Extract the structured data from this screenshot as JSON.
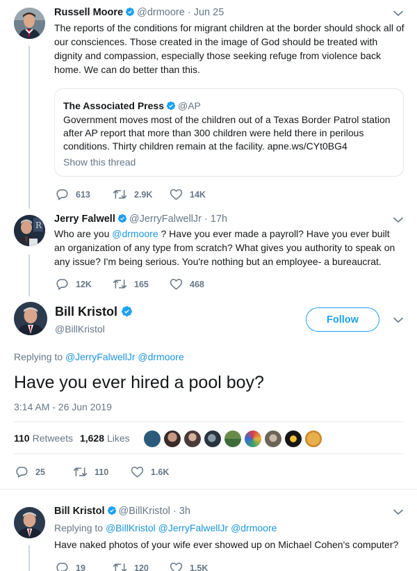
{
  "tweet1": {
    "name": "Russell Moore",
    "handle": "@drmoore",
    "sep": " · ",
    "time": "Jun 25",
    "text": "The reports of the conditions for migrant children at the border should shock all of our consciences. Those created in the image of God should be treated with dignity and compassion, especially those seeking refuge from violence back home. We can do better than this.",
    "quote": {
      "name": "The Associated Press",
      "handle": "@AP",
      "text": "Government moves most of the children out of a Texas Border Patrol station after AP report that more than 300 children were held there in perilous conditions. Thirty children remain at the facility. apne.ws/CYt0BG4",
      "link": "Show this thread"
    },
    "replies": "613",
    "retweets": "2.9K",
    "likes": "14K"
  },
  "tweet2": {
    "name": "Jerry Falwell",
    "handle": "@JerryFalwellJr",
    "sep": " · ",
    "time": "17h",
    "text_before": "Who are you ",
    "mention": "@drmoore",
    "text_after": " ?  Have you ever made a payroll?  Have you ever built an organization of any type from scratch?  What gives you authority to speak on any issue?  I'm being serious.  You're nothing but an employee- a bureaucrat.",
    "replies": "12K",
    "retweets": "165",
    "likes": "468"
  },
  "focused": {
    "name": "Bill Kristol",
    "handle": "@BillKristol",
    "follow_label": "Follow",
    "replying_label": "Replying to",
    "replying_to_1": "@JerryFalwellJr",
    "replying_to_2": "@drmoore",
    "text": "Have you ever hired a pool boy?",
    "timestamp": "3:14 AM - 26 Jun 2019",
    "retweet_count": "110",
    "retweet_label": "Retweets",
    "like_count": "1,628",
    "like_label": "Likes",
    "replies": "25",
    "retweets": "110",
    "likes": "1.6K"
  },
  "tweet4": {
    "name": "Bill Kristol",
    "handle": "@BillKristol",
    "sep": " · ",
    "time": "3h",
    "replying_label": "Replying to",
    "replying_to_1": "@BillKristol",
    "replying_to_2": "@JerryFalwellJr",
    "replying_to_3": "@drmoore",
    "text": "Have naked photos of your wife ever showed up on Michael Cohen's computer?",
    "replies": "19",
    "retweets": "120",
    "likes": "1.5K"
  },
  "colors": {
    "accent": "#1da1f2",
    "link": "#1b95e0",
    "muted": "#657786",
    "line": "#ccd6dd"
  },
  "icons": [
    "verified-badge-icon",
    "chevron-down-icon",
    "reply-icon",
    "retweet-icon",
    "like-icon"
  ]
}
